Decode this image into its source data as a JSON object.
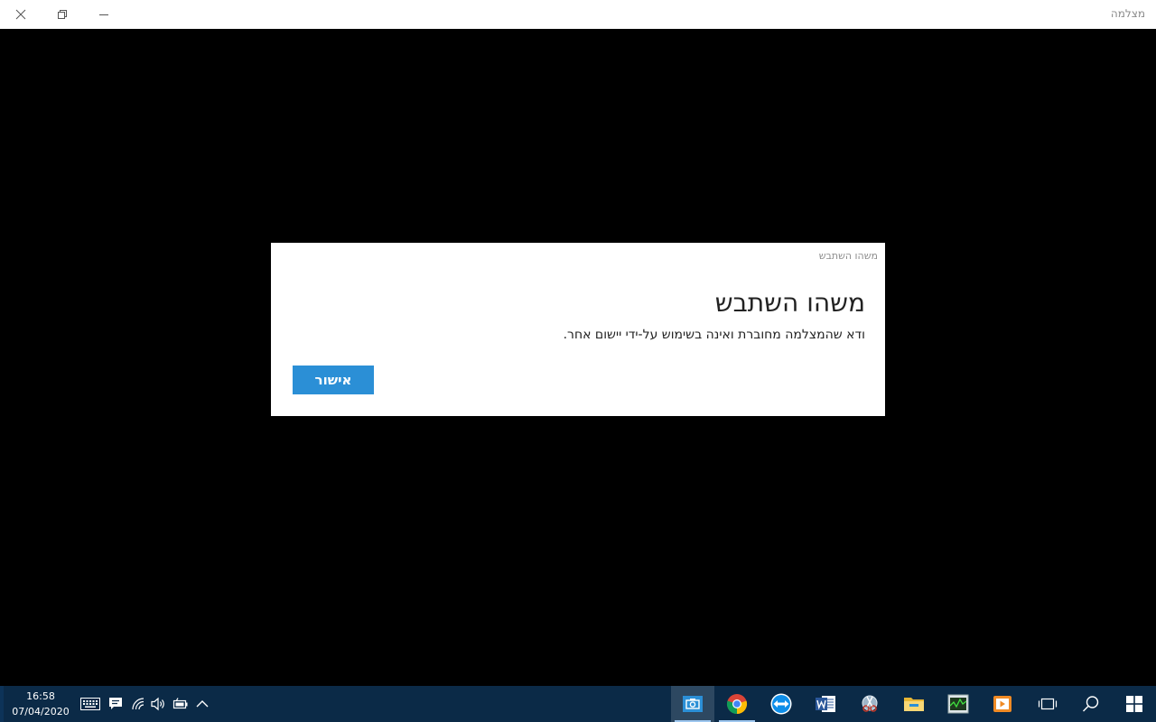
{
  "window": {
    "title": "מצלמה"
  },
  "dialog": {
    "caption": "משהו השתבש",
    "heading": "משהו השתבש",
    "message": "ודא שהמצלמה מחוברת ואינה בשימוש על-ידי יישום אחר.",
    "ok_label": "אישור"
  },
  "taskbar": {
    "time": "16:58",
    "date": "07/04/2020",
    "tray_icons": [
      "keyboard-icon",
      "notification-icon",
      "wifi-icon",
      "volume-icon",
      "battery-icon",
      "chevron-up-icon"
    ],
    "apps": [
      "camera-icon",
      "chrome-icon",
      "teamviewer-icon",
      "word-icon",
      "snipping-tool-icon",
      "file-explorer-icon",
      "task-manager-icon",
      "media-player-icon"
    ],
    "system_buttons": [
      "task-view-icon",
      "search-icon",
      "windows-start-icon"
    ]
  },
  "colors": {
    "accent": "#2b8fd6",
    "taskbar": "#0b2a47",
    "background": "#000000"
  }
}
